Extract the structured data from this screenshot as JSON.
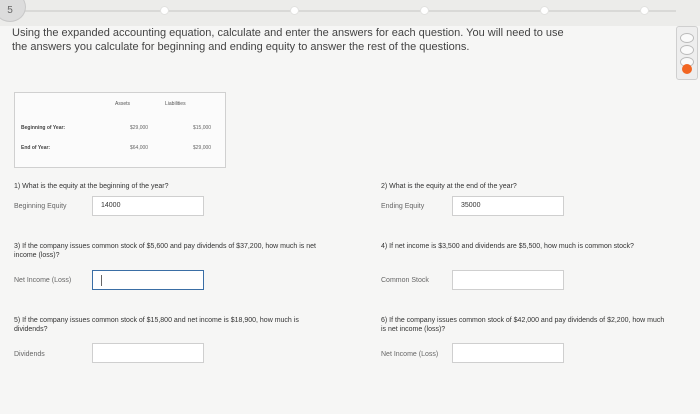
{
  "question_number": "5",
  "instructions": "Using the expanded accounting equation, calculate and enter the answers for each question. You will need to use the answers you calculate for beginning and ending equity to answer the rest of the questions.",
  "table": {
    "headers": [
      "Assets",
      "Liabilities"
    ],
    "rows": [
      {
        "label": "Beginning of Year:",
        "assets": "$29,000",
        "liabilities": "$15,000"
      },
      {
        "label": "End of Year:",
        "assets": "$64,000",
        "liabilities": "$29,000"
      }
    ]
  },
  "questions": [
    {
      "text": "1) What is the equity at the beginning of the year?",
      "label": "Beginning Equity",
      "value": "14000"
    },
    {
      "text": "2) What is the equity at the end of the year?",
      "label": "Ending Equity",
      "value": "35000"
    },
    {
      "text": "3) If the company issues common stock of $5,600 and pay dividends of $37,200, how much is net income (loss)?",
      "label": "Net Income (Loss)",
      "value": ""
    },
    {
      "text": "4) If net income is $3,500 and dividends are $5,500, how much is common stock?",
      "label": "Common Stock",
      "value": ""
    },
    {
      "text": "5) If the company issues common stock of $15,800 and net income is $18,900, how much is dividends?",
      "label": "Dividends",
      "value": ""
    },
    {
      "text": "6) If the company issues common stock of $42,000 and pay dividends of $2,200, how much is net income (loss)?",
      "label": "Net Income (Loss)",
      "value": ""
    }
  ],
  "colors": {
    "accent": "#f26522",
    "focus_border": "#3a6ea5"
  }
}
